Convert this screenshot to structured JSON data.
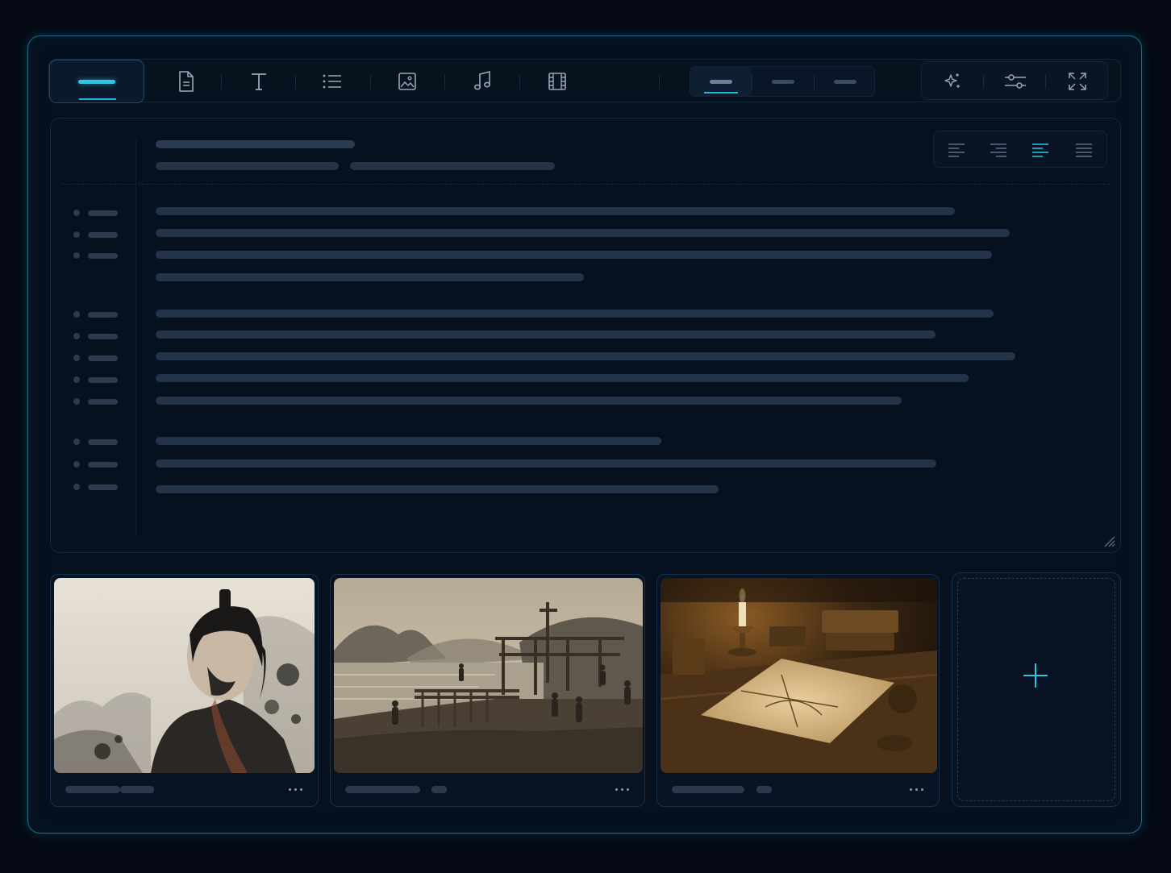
{
  "toolbar": {
    "tools": [
      {
        "name": "menu",
        "icon": "menu-bar-icon",
        "active": true
      },
      {
        "name": "document",
        "icon": "document-icon"
      },
      {
        "name": "text",
        "icon": "text-icon"
      },
      {
        "name": "list",
        "icon": "list-icon"
      },
      {
        "name": "image",
        "icon": "image-icon"
      },
      {
        "name": "audio",
        "icon": "music-note-icon"
      },
      {
        "name": "video",
        "icon": "film-icon"
      }
    ],
    "view_modes": {
      "count": 3,
      "active_index": 0
    },
    "actions": [
      {
        "icon": "sparkles-icon"
      },
      {
        "icon": "sliders-icon"
      },
      {
        "icon": "fullscreen-icon"
      }
    ]
  },
  "editor": {
    "alignment": {
      "options": [
        "align-left-icon",
        "align-right-icon",
        "align-center-icon",
        "align-justify-icon"
      ],
      "active_index": 2
    }
  },
  "media": {
    "cards": [
      {
        "image": "ink-wash-portrait-of-samurai"
      },
      {
        "image": "lakeside-construction-scene"
      },
      {
        "image": "candlelit-desk-with-map"
      }
    ],
    "add_button_icon": "plus-icon"
  },
  "colors": {
    "accent": "#29c6e6",
    "frame_border": "#1b6f8e",
    "background": "#050a14",
    "panel": "#061120",
    "placeholder": "#243448"
  }
}
